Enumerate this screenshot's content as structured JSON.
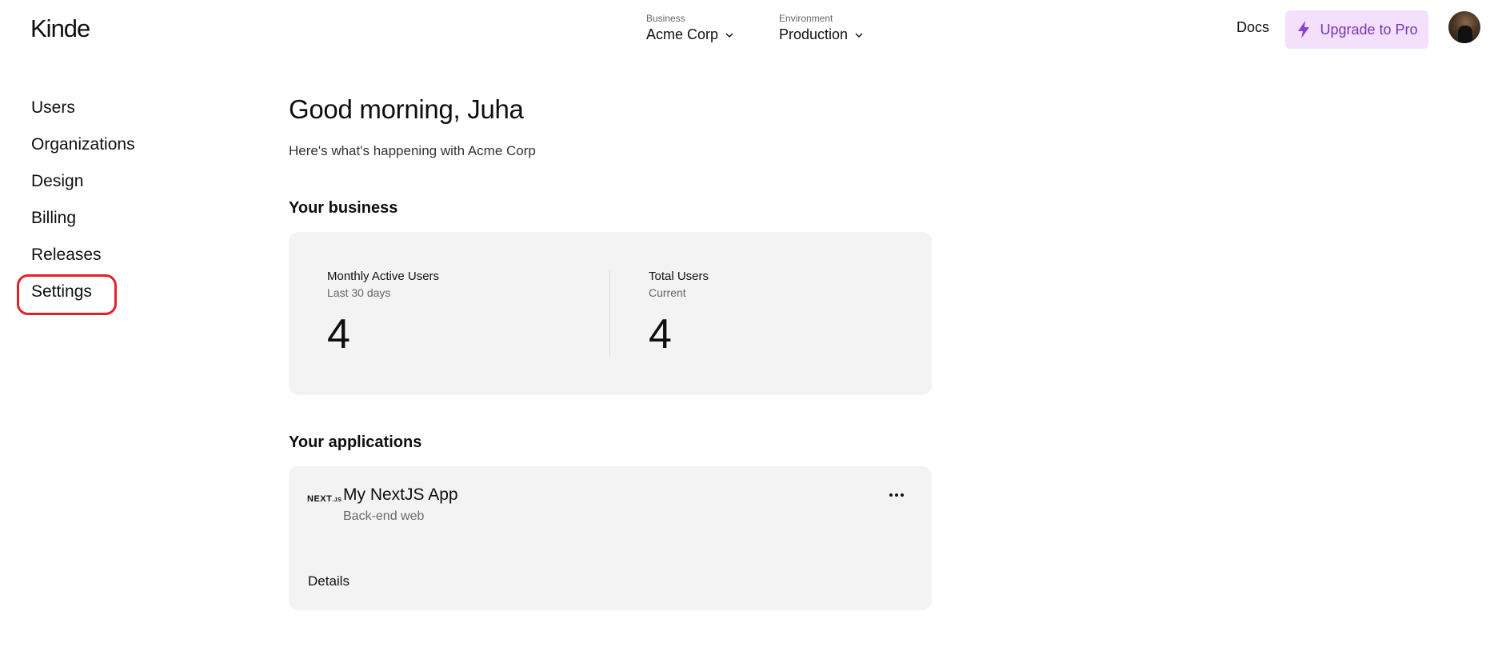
{
  "header": {
    "logo": "Kinde",
    "business_caption": "Business",
    "business_value": "Acme Corp",
    "environment_caption": "Environment",
    "environment_value": "Production",
    "docs_label": "Docs",
    "upgrade_label": "Upgrade to Pro",
    "accent_color": "#7a34b8",
    "upgrade_bg": "#f3e1fb"
  },
  "sidebar": {
    "items": [
      {
        "label": "Users"
      },
      {
        "label": "Organizations"
      },
      {
        "label": "Design"
      },
      {
        "label": "Billing"
      },
      {
        "label": "Releases"
      },
      {
        "label": "Settings"
      }
    ],
    "highlight_color": "#e3202a"
  },
  "main": {
    "greeting": "Good morning, Juha",
    "subtitle": "Here's what's happening with Acme Corp",
    "business_title": "Your business",
    "stats": [
      {
        "label": "Monthly Active Users",
        "period": "Last 30 days",
        "value": "4"
      },
      {
        "label": "Total Users",
        "period": "Current",
        "value": "4"
      }
    ],
    "apps_title": "Your applications",
    "apps": [
      {
        "logo": "NEXT.js",
        "name": "My NextJS App",
        "type": "Back-end web",
        "details_label": "Details"
      }
    ]
  }
}
